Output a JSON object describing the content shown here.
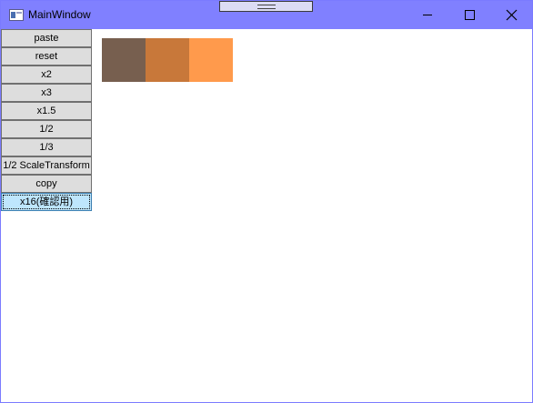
{
  "window": {
    "title": "MainWindow",
    "accent": "#8080ff"
  },
  "caption_buttons": [
    {
      "name": "minimize",
      "icon": "minimize-icon"
    },
    {
      "name": "maximize",
      "icon": "maximize-icon"
    },
    {
      "name": "close",
      "icon": "close-icon"
    }
  ],
  "toolbar": {
    "buttons": [
      {
        "label": "paste"
      },
      {
        "label": "reset"
      },
      {
        "label": "x2"
      },
      {
        "label": "x3"
      },
      {
        "label": "x1.5"
      },
      {
        "label": "1/2"
      },
      {
        "label": "1/3"
      },
      {
        "label": "1/2 ScaleTransform"
      },
      {
        "label": "copy"
      },
      {
        "label": "x16(確認用)",
        "focused": true
      }
    ]
  },
  "swatches": [
    {
      "color": "#775f4f"
    },
    {
      "color": "#c8783a"
    },
    {
      "color": "#ff9a4c"
    }
  ]
}
